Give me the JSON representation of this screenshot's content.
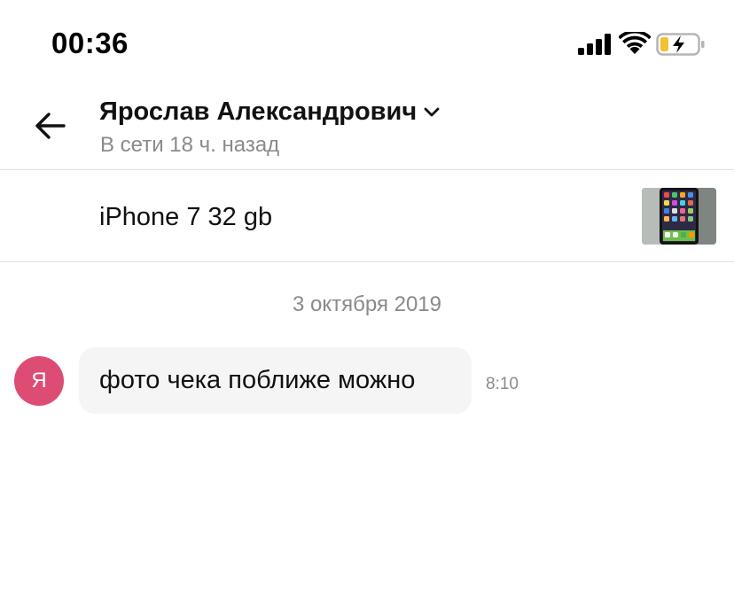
{
  "status_bar": {
    "time": "00:36",
    "signal_icon": "signal-bars-icon",
    "wifi_icon": "wifi-icon",
    "battery_icon": "battery-charging-icon",
    "battery_color": "#f2c230"
  },
  "header": {
    "back_icon": "arrow-left-icon",
    "contact_name": "Ярослав Александрович",
    "chevron_icon": "chevron-down-icon",
    "status": "В сети 18 ч. назад"
  },
  "listing": {
    "title": "iPhone 7 32 gb",
    "thumbnail_icon": "product-photo-thumbnail"
  },
  "chat": {
    "date_separator": "3 октября 2019",
    "messages": [
      {
        "avatar_letter": "Я",
        "avatar_color": "#dc4c73",
        "text": "фото чека поближе можно",
        "time": "8:10"
      }
    ]
  }
}
